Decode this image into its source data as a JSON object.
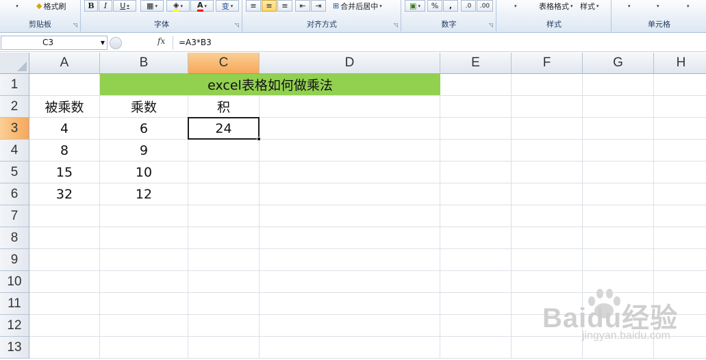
{
  "ribbon": {
    "groups": [
      {
        "label": "剪贴板",
        "tools": [
          "格式刷"
        ]
      },
      {
        "label": "字体",
        "tools": [
          "B",
          "I",
          "U",
          "A",
          "变"
        ]
      },
      {
        "label": "对齐方式",
        "tools": [
          "合并后居中"
        ]
      },
      {
        "label": "数字",
        "tools": [
          "%",
          ",",
          ".0",
          ".00"
        ]
      },
      {
        "label": "样式",
        "tools": [
          "表格格式",
          "样式"
        ]
      },
      {
        "label": "单元格",
        "tools": []
      }
    ]
  },
  "formula_bar": {
    "name_box": "C3",
    "fx_label": "fx",
    "formula": "=A3*B3"
  },
  "grid": {
    "columns": [
      "A",
      "B",
      "C",
      "D",
      "E",
      "F",
      "G",
      "H"
    ],
    "selected_column": "C",
    "rows": [
      "1",
      "2",
      "3",
      "4",
      "5",
      "6",
      "7",
      "8",
      "9",
      "10",
      "11",
      "12",
      "13"
    ],
    "selected_row": "3",
    "title": "excel表格如何做乘法",
    "title_fill": "#92d050",
    "cells": {
      "A2": "被乘数",
      "B2": "乘数",
      "C2": "积",
      "A3": "4",
      "B3": "6",
      "C3": "24",
      "A4": "8",
      "B4": "9",
      "A5": "15",
      "B5": "10",
      "A6": "32",
      "B6": "12"
    },
    "active_cell": "C3"
  },
  "watermark": {
    "main": "Baidu经验",
    "sub": "jingyan.baidu.com"
  },
  "colors": {
    "header_selected": "#f6a75a",
    "grid_line": "#dadfe6"
  }
}
